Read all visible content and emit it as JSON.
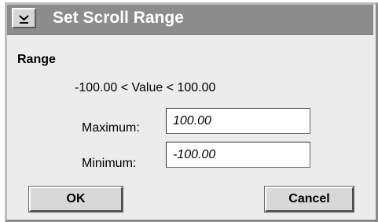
{
  "window": {
    "title": "Set Scroll Range",
    "menu_icon": "chevron-down-icon"
  },
  "range": {
    "label": "Range",
    "description": "-100.00 < Value < 100.00"
  },
  "fields": {
    "maximum": {
      "label": "Maximum:",
      "value": "100.00"
    },
    "minimum": {
      "label": "Minimum:",
      "value": "-100.00"
    }
  },
  "buttons": {
    "ok": "OK",
    "cancel": "Cancel"
  }
}
